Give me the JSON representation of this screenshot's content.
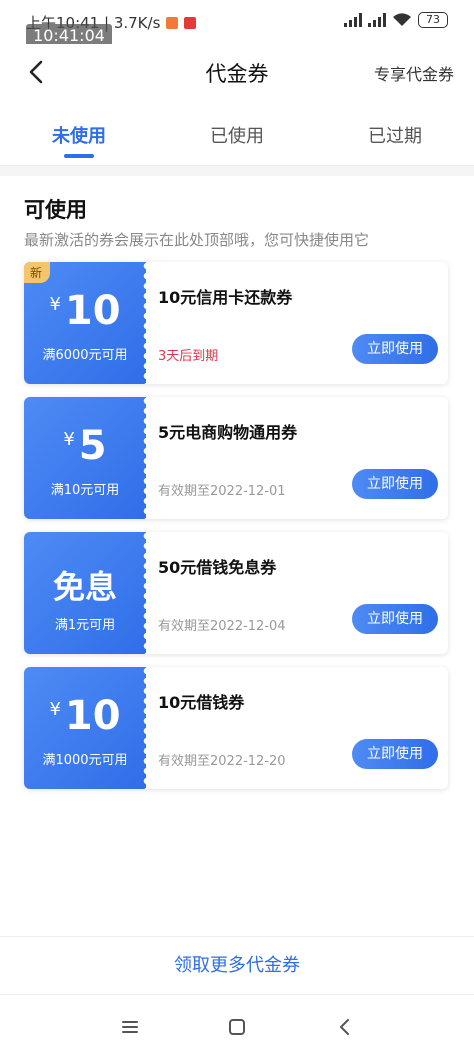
{
  "status_bar": {
    "left_text": "上午10:41 | 3.7K/s",
    "time_overlay": "10:41:04",
    "battery": "73"
  },
  "header": {
    "title": "代金券",
    "right_link": "专享代金券"
  },
  "tabs": [
    {
      "label": "未使用",
      "active": true
    },
    {
      "label": "已使用",
      "active": false
    },
    {
      "label": "已过期",
      "active": false
    }
  ],
  "section": {
    "title": "可使用",
    "description": "最新激活的券会展示在此处顶部哦，您可快捷使用它"
  },
  "coupons": [
    {
      "tag": "新",
      "symbol": "¥",
      "amount": "10",
      "condition": "满6000元可用",
      "name": "10元信用卡还款券",
      "expiry": "3天后到期",
      "button": "立即使用"
    },
    {
      "symbol": "¥",
      "amount": "5",
      "condition": "满10元可用",
      "name": "5元电商购物通用券",
      "expiry": "有效期至2022-12-01",
      "button": "立即使用"
    },
    {
      "amount_text": "免息",
      "condition": "满1元可用",
      "name": "50元借钱免息券",
      "expiry": "有效期至2022-12-04",
      "button": "立即使用"
    },
    {
      "symbol": "¥",
      "amount": "10",
      "condition": "满1000元可用",
      "name": "10元借钱券",
      "expiry": "有效期至2022-12-20",
      "button": "立即使用"
    }
  ],
  "footer": {
    "link": "领取更多代金券"
  },
  "colors": {
    "accent": "#2f6ee8",
    "warning": "#e0344b",
    "new_tag": "#f4c66b"
  }
}
